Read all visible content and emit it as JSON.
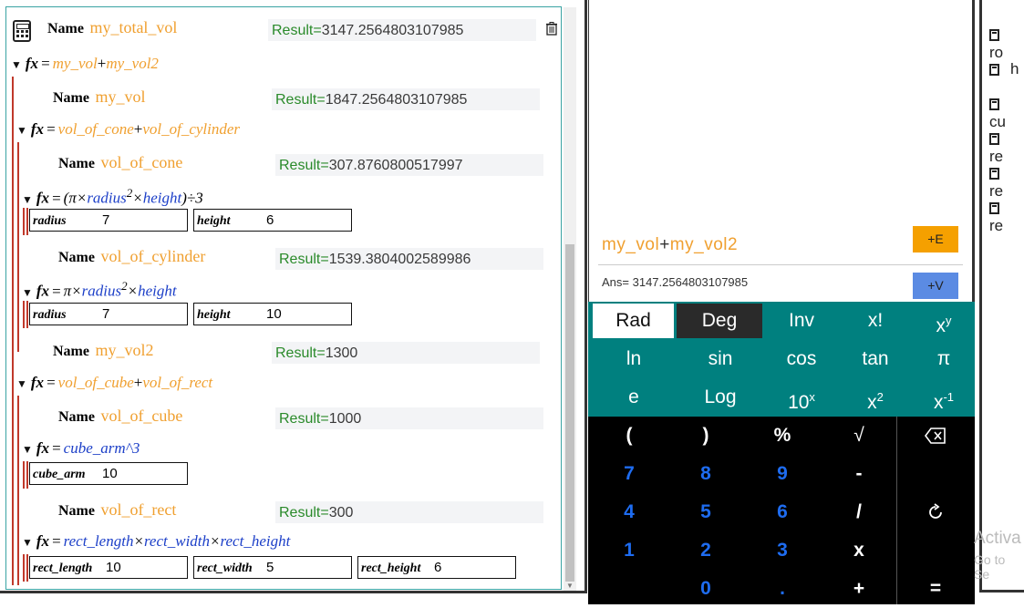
{
  "formula_panel": {
    "blocks": {
      "total": {
        "name_label": "Name",
        "name": "my_total_vol",
        "result_label": "Result=",
        "result": "3147.2564803107985"
      },
      "total_fx": {
        "fx_label": "fx",
        "eq": "=",
        "a": "my_vol",
        "op": "+",
        "b": "my_vol2"
      },
      "vol": {
        "name_label": "Name",
        "name": "my_vol",
        "result_label": "Result=",
        "result": "1847.2564803107985"
      },
      "vol_fx": {
        "fx_label": "fx",
        "eq": "=",
        "a": "vol_of_cone",
        "op": "+",
        "b": "vol_of_cylinder"
      },
      "cone": {
        "name_label": "Name",
        "name": "vol_of_cone",
        "result_label": "Result=",
        "result": "307.8760800517997"
      },
      "cone_fx": {
        "fx_label": "fx",
        "eq": "=",
        "text": "(π×",
        "v1": "radius",
        "sup": "2",
        "mid": "×",
        "v2": "height",
        "tail": ")÷3"
      },
      "cone_vars": [
        {
          "name": "radius",
          "value": "7"
        },
        {
          "name": "height",
          "value": "6"
        }
      ],
      "cyl": {
        "name_label": "Name",
        "name": "vol_of_cylinder",
        "result_label": "Result=",
        "result": "1539.3804002589986"
      },
      "cyl_fx": {
        "fx_label": "fx",
        "eq": "=",
        "text": "π×",
        "v1": "radius",
        "sup": "2",
        "mid": "×",
        "v2": "height"
      },
      "cyl_vars": [
        {
          "name": "radius",
          "value": "7"
        },
        {
          "name": "height",
          "value": "10"
        }
      ],
      "vol2": {
        "name_label": "Name",
        "name": "my_vol2",
        "result_label": "Result=",
        "result": "1300"
      },
      "vol2_fx": {
        "fx_label": "fx",
        "eq": "=",
        "a": "vol_of_cube",
        "op": "+",
        "b": "vol_of_rect"
      },
      "cube": {
        "name_label": "Name",
        "name": "vol_of_cube",
        "result_label": "Result=",
        "result": "1000"
      },
      "cube_fx": {
        "fx_label": "fx",
        "eq": "=",
        "v1": "cube_arm",
        "tail": "^3"
      },
      "cube_vars": [
        {
          "name": "cube_arm",
          "value": "10"
        }
      ],
      "rect": {
        "name_label": "Name",
        "name": "vol_of_rect",
        "result_label": "Result=",
        "result": "300"
      },
      "rect_fx": {
        "fx_label": "fx",
        "eq": "=",
        "v1": "rect_length",
        "m1": "×",
        "v2": "rect_width",
        "m2": "×",
        "v3": "rect_height"
      },
      "rect_vars": [
        {
          "name": "rect_length",
          "value": "10"
        },
        {
          "name": "rect_width",
          "value": "5"
        },
        {
          "name": "rect_height",
          "value": "6"
        }
      ]
    }
  },
  "calculator": {
    "expression": {
      "a": "my_vol",
      "op": "+",
      "b": "my_vol2"
    },
    "add_expression_button": "+E",
    "answer": "Ans= 3147.2564803107985",
    "add_variable_button": "+V",
    "sci_keys": {
      "rad": "Rad",
      "deg": "Deg",
      "inv": "Inv",
      "fact": "x!",
      "pow_base": "x",
      "pow_sup": "y",
      "ln": "ln",
      "sin": "sin",
      "cos": "cos",
      "tan": "tan",
      "pi": "π",
      "e": "e",
      "log": "Log",
      "tenx_base": "10",
      "tenx_sup": "x",
      "sq_base": "x",
      "sq_sup": "2",
      "recip_base": "x",
      "recip_sup": "-1"
    },
    "num_keys": {
      "lparen": "(",
      "rparen": ")",
      "percent": "%",
      "sqrt": "√",
      "d7": "7",
      "d8": "8",
      "d9": "9",
      "minus": "-",
      "d4": "4",
      "d5": "5",
      "d6": "6",
      "div": "/",
      "d1": "1",
      "d2": "2",
      "d3": "3",
      "mul": "x",
      "d0": "0",
      "dot": ".",
      "plus": "+",
      "equals": "="
    }
  },
  "right_fragment": {
    "items": [
      "ro",
      "h",
      "cu",
      "re",
      "re",
      "re"
    ],
    "watermark_line1": "Activa",
    "watermark_line2": "Go to Se"
  }
}
